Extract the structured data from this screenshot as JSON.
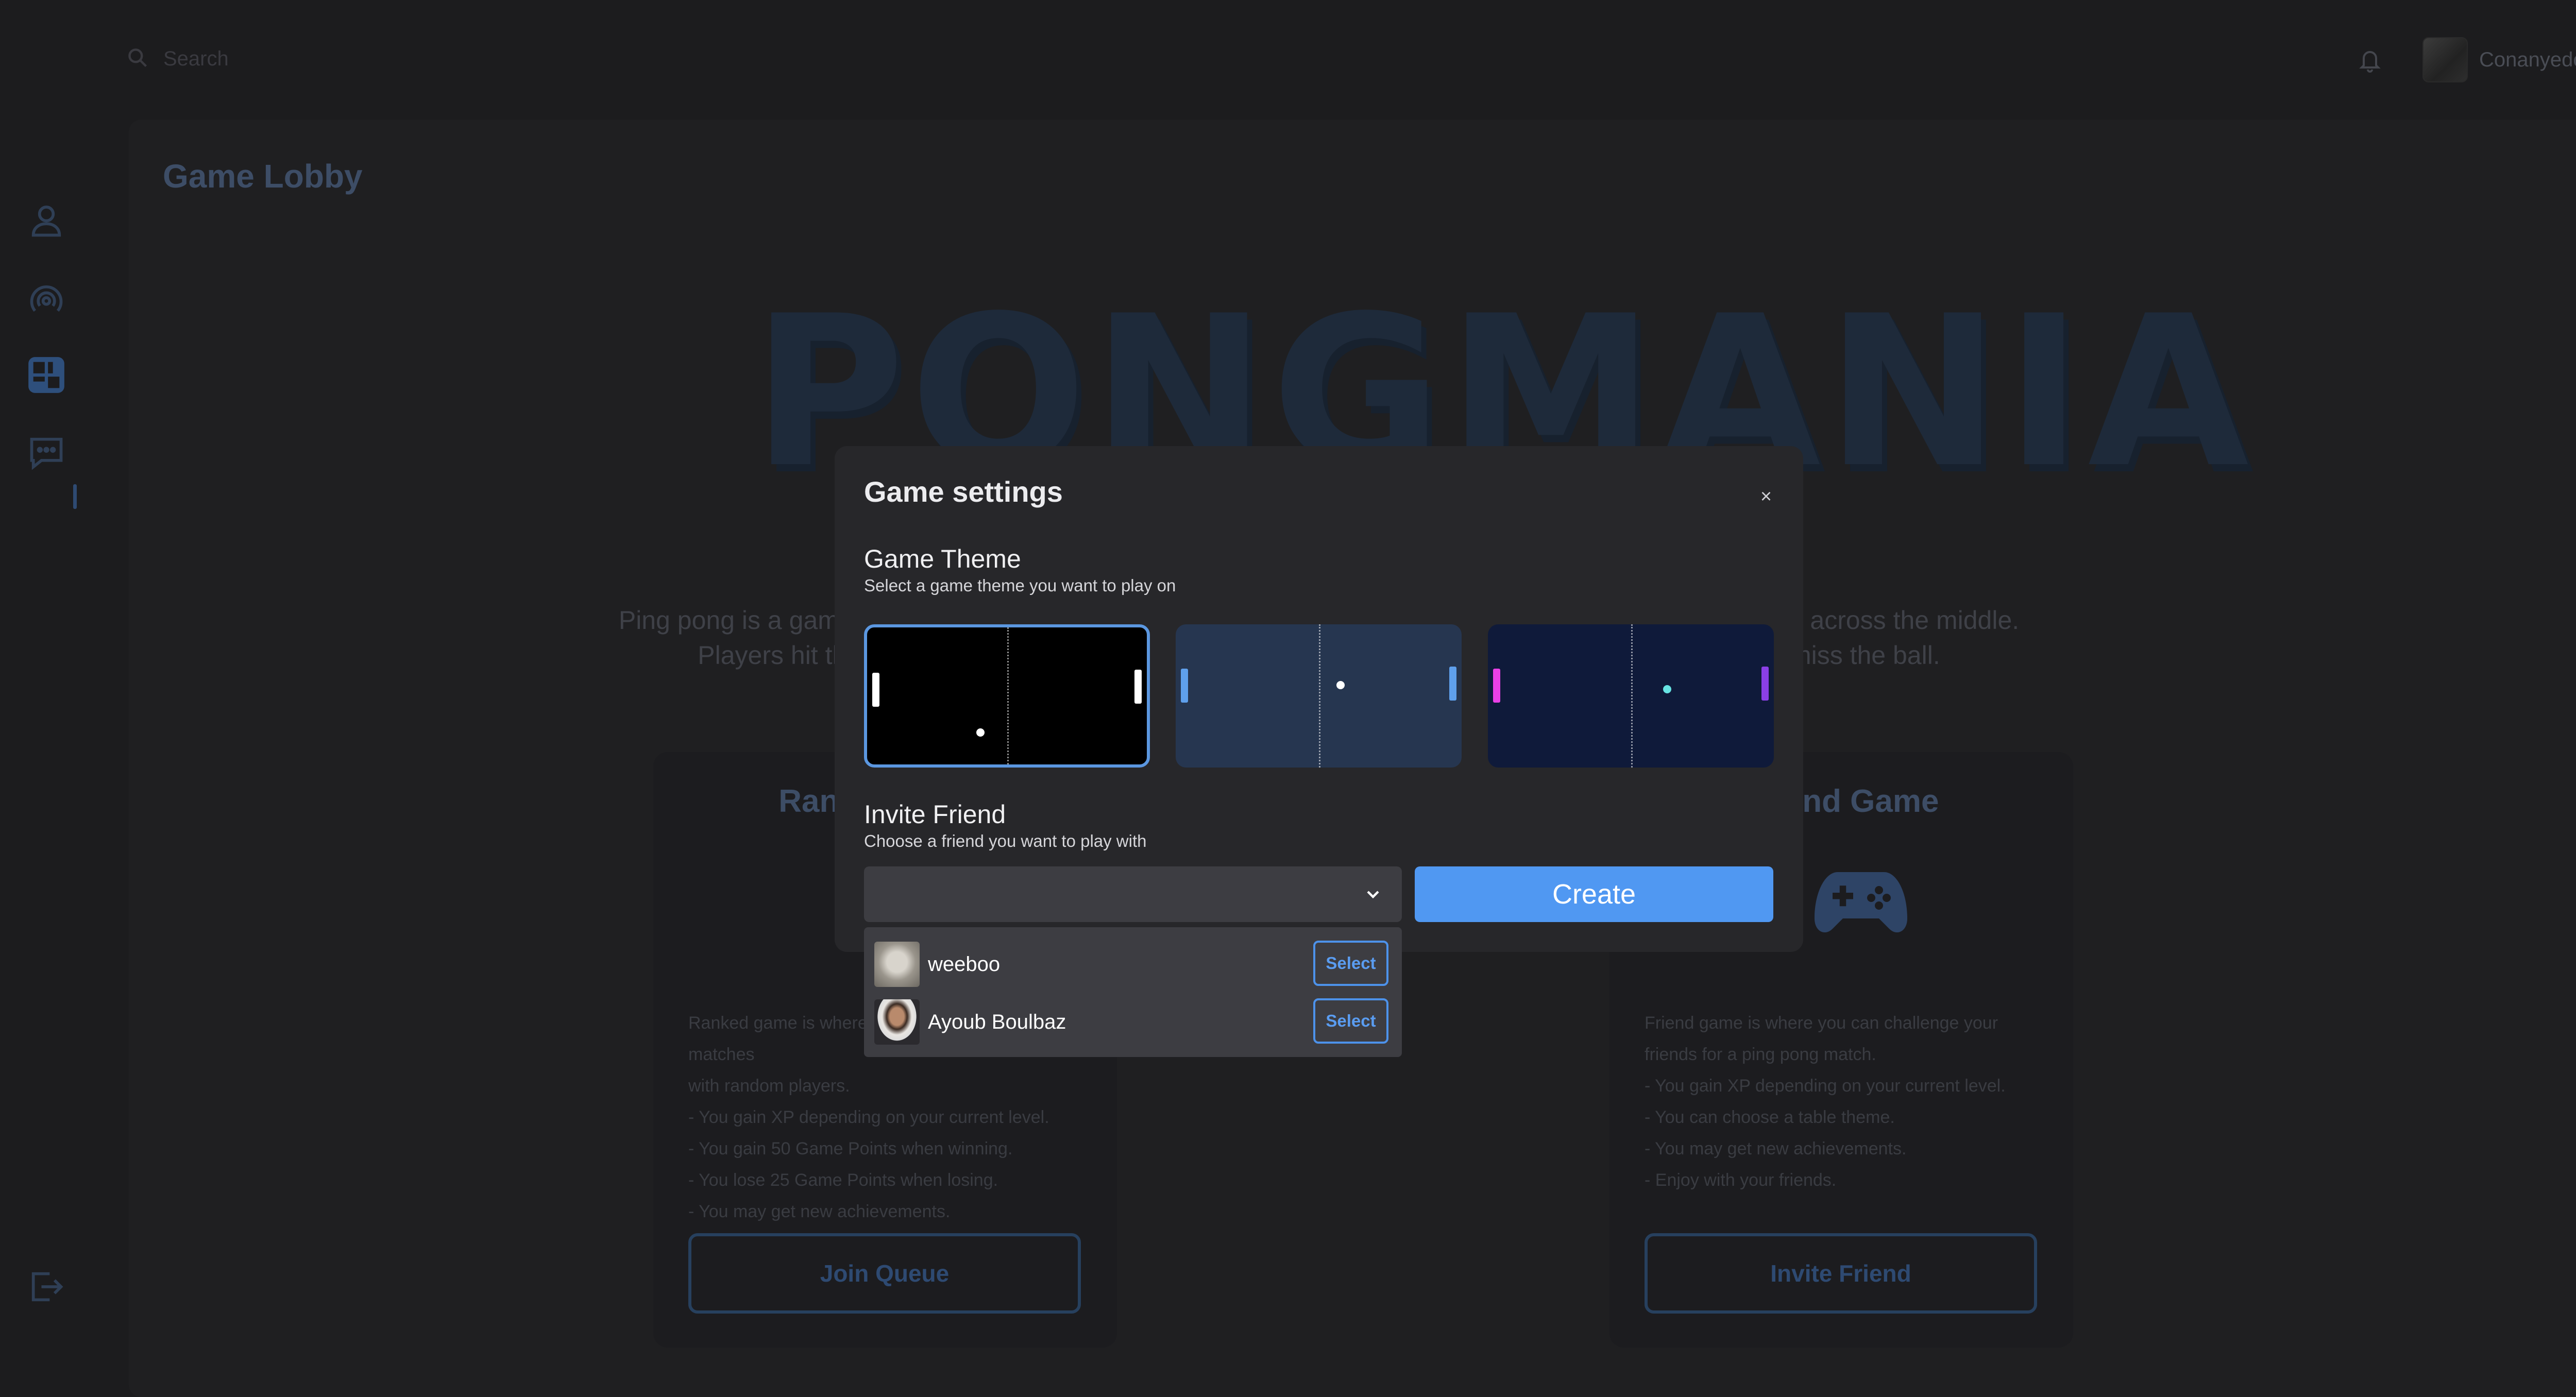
{
  "header": {
    "search_placeholder": "Search",
    "user_name": "Conanyedo"
  },
  "sidebar": {
    "items": [
      {
        "icon": "user-icon"
      },
      {
        "icon": "broadcast-icon"
      },
      {
        "icon": "game-icon",
        "active": true
      },
      {
        "icon": "chat-icon"
      }
    ],
    "logout_icon": "logout-icon"
  },
  "page": {
    "title": "Game Lobby",
    "logo_text": "PONGMANIA",
    "description_line1": "Ping pong is a game played between two players. Each player has a paddle and there is a net stretched across the middle.",
    "description_line2": "Players hit the ball back and forth over the net. The aim of the game is to make the other player miss the ball."
  },
  "cards": {
    "ranked": {
      "title": "Ranked Game",
      "body": [
        "Ranked game is where you can play ranked matches",
        "with random players.",
        "- You gain XP depending on your current level.",
        "- You gain 50 Game Points when winning.",
        "- You lose 25 Game Points when losing.",
        "- You may get new achievements."
      ],
      "button": "Join Queue"
    },
    "friend": {
      "title": "Friend Game",
      "body": [
        "Friend game is where you can challenge your",
        "friends for a ping pong match.",
        "- You gain XP depending on your current level.",
        "- You can choose a table theme.",
        "- You may get new achievements.",
        "- Enjoy with your friends."
      ],
      "button": "Invite Friend"
    }
  },
  "modal": {
    "title": "Game settings",
    "close_label": "×",
    "theme_section": {
      "title": "Game Theme",
      "subtitle": "Select a game theme you want to play on",
      "selected_index": 0,
      "themes": [
        {
          "background": "#000000",
          "paddle_left": "#ffffff",
          "paddle_right": "#ffffff",
          "ball": "#ffffff"
        },
        {
          "background": "#263650",
          "paddle_left": "#5fa0ec",
          "paddle_right": "#5fa0ec",
          "ball": "#ffffff"
        },
        {
          "background": "#0f1a3a",
          "paddle_left": "#e940e6",
          "paddle_right": "#8b3fe6",
          "ball": "#67e3e3"
        }
      ]
    },
    "invite_section": {
      "title": "Invite Friend",
      "subtitle": "Choose a friend you want to play with",
      "selected_value": ""
    },
    "create_label": "Create",
    "friends": [
      {
        "name": "weeboo",
        "select_label": "Select"
      },
      {
        "name": "Ayoub Boulbaz",
        "select_label": "Select"
      }
    ]
  },
  "colors": {
    "accent": "#5098f2",
    "modal_bg": "#27272a",
    "page_bg": "#1c1c1e"
  }
}
